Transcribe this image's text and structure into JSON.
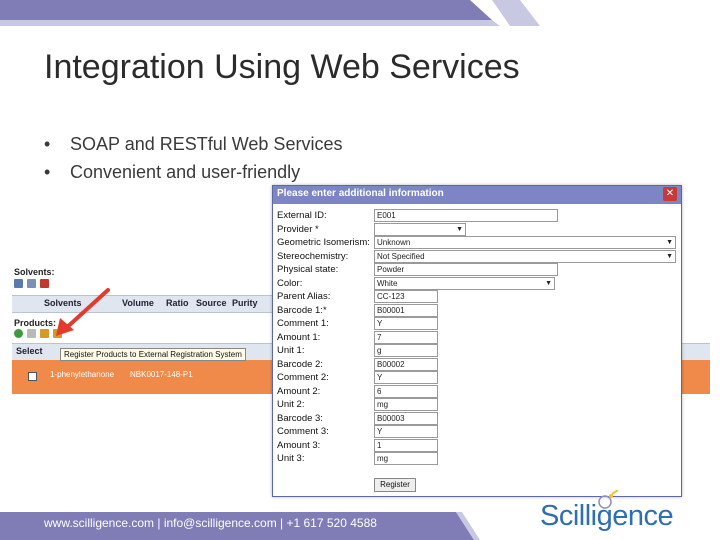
{
  "slide": {
    "title": "Integration Using Web Services",
    "bullets": [
      "SOAP and RESTful Web Services",
      "Convenient and user-friendly"
    ]
  },
  "colors": {
    "band_purple": "#7f7cb6",
    "band_light": "#c9c8e3",
    "dialog_header": "#7d85c4",
    "row_orange": "#f08a4b",
    "logo_blue": "#2c6fb2"
  },
  "background_app": {
    "solvents_label": "Solvents:",
    "solvents_columns": [
      "Solvents",
      "Volume",
      "Ratio",
      "Source",
      "Purity"
    ],
    "products_label": "Products:",
    "products_columns": [
      "Select"
    ],
    "tooltip": "Register Products to External Registration System",
    "row_values": [
      "1-phenylethanone",
      "NBK0017-148-P1"
    ]
  },
  "dialog": {
    "title": "Please enter additional information",
    "close_icon": "close-icon",
    "fields": [
      {
        "label": "External ID:",
        "value": "E001",
        "type": "text"
      },
      {
        "label": "Provider *",
        "value": "",
        "type": "select"
      },
      {
        "label": "Geometric Isomerism:",
        "value": "Unknown",
        "type": "select"
      },
      {
        "label": "Stereochemistry:",
        "value": "Not Specified",
        "type": "select"
      },
      {
        "label": "Physical state:",
        "value": "Powder",
        "type": "text"
      },
      {
        "label": "Color:",
        "value": "White",
        "type": "select"
      },
      {
        "label": "Parent Alias:",
        "value": "CC-123",
        "type": "text"
      },
      {
        "label": "Barcode 1:*",
        "value": "B00001",
        "type": "text"
      },
      {
        "label": "Comment 1:",
        "value": "Y",
        "type": "text"
      },
      {
        "label": "Amount 1:",
        "value": "7",
        "type": "text"
      },
      {
        "label": "Unit 1:",
        "value": "g",
        "type": "text"
      },
      {
        "label": "Barcode 2:",
        "value": "B00002",
        "type": "text"
      },
      {
        "label": "Comment 2:",
        "value": "Y",
        "type": "text"
      },
      {
        "label": "Amount 2:",
        "value": "6",
        "type": "text"
      },
      {
        "label": "Unit 2:",
        "value": "mg",
        "type": "text"
      },
      {
        "label": "Barcode 3:",
        "value": "B00003",
        "type": "text"
      },
      {
        "label": "Comment 3:",
        "value": "Y",
        "type": "text"
      },
      {
        "label": "Amount 3:",
        "value": "1",
        "type": "text"
      },
      {
        "label": "Unit 3:",
        "value": "mg",
        "type": "text"
      }
    ],
    "register_label": "Register"
  },
  "footer": {
    "contact": "www.scilligence.com | info@scilligence.com | +1 617 520 4588",
    "logo": "Scilligence"
  }
}
